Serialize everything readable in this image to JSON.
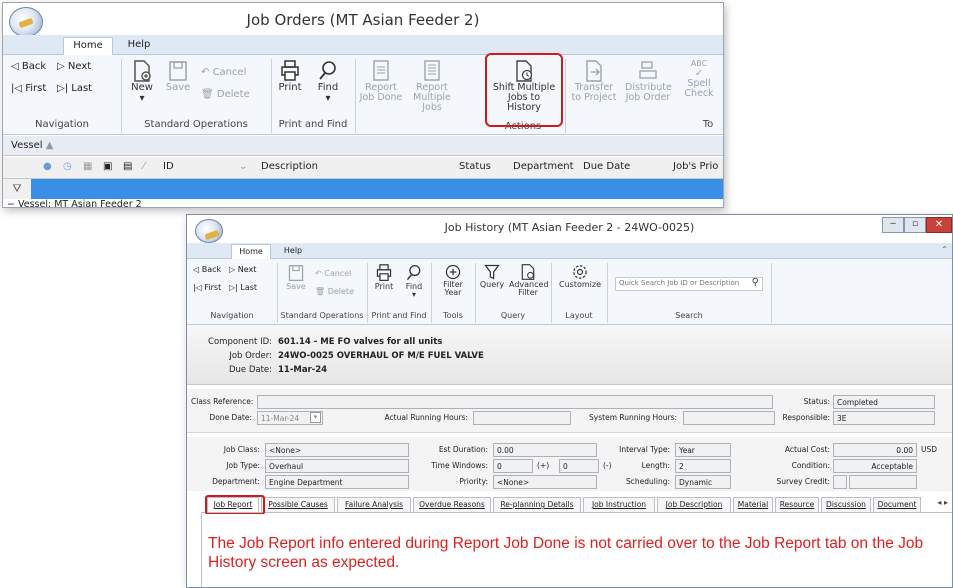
{
  "back_window": {
    "title": "Job Orders (MT Asian Feeder 2)",
    "tabs": [
      "Home",
      "Help"
    ],
    "navigation": {
      "back": "Back",
      "next": "Next",
      "first": "First",
      "last": "Last",
      "group": "Navigation"
    },
    "standard_ops": {
      "new": "New",
      "save": "Save",
      "cancel": "Cancel",
      "delete": "Delete",
      "group": "Standard Operations"
    },
    "print_find": {
      "print": "Print",
      "find": "Find",
      "group": "Print and Find"
    },
    "actions": {
      "report_job_done": "Report Job Done",
      "report_multiple_jobs": "Report Multiple Jobs",
      "shift_multiple_jobs": "Shift Multiple Jobs to History",
      "group": "Actions"
    },
    "more": {
      "transfer_to_project": "Transfer to Project",
      "distribute_job_order": "Distribute Job Order",
      "spell_check": "Spell Check",
      "abc": "ABC",
      "tools_group": "To"
    },
    "group_by": "Vessel",
    "columns": [
      "ID",
      "Description",
      "Status",
      "Department",
      "Due Date",
      "Job's Prio"
    ],
    "group_row": "Vessel:  MT Asian Feeder 2"
  },
  "front_window": {
    "title": "Job History (MT Asian Feeder 2 - 24WO-0025)",
    "tabs": [
      "Home",
      "Help"
    ],
    "navigation": {
      "back": "Back",
      "next": "Next",
      "first": "First",
      "last": "Last",
      "group": "Navigation"
    },
    "standard_ops": {
      "save": "Save",
      "cancel": "Cancel",
      "delete": "Delete",
      "group": "Standard Operations"
    },
    "print_find": {
      "print": "Print",
      "find": "Find",
      "group": "Print and Find"
    },
    "tools": {
      "filter_year": "Filter Year",
      "group": "Tools"
    },
    "query": {
      "query": "Query",
      "advanced_filter": "Advanced Filter",
      "group": "Query"
    },
    "layout": {
      "customize": "Customize",
      "group": "Layout"
    },
    "search": {
      "placeholder": "Quick Search Job ID or Description",
      "group": "Search"
    },
    "header": {
      "component_label": "Component ID:",
      "component_value": "601.14 - ME FO valves for all units",
      "job_order_label": "Job Order:",
      "job_order_value": "24WO-0025 OVERHAUL OF M/E FUEL VALVE",
      "due_label": "Due Date:",
      "due_value": "11-Mar-24"
    },
    "form": {
      "class_reference_label": "Class Reference:",
      "class_reference": "",
      "status_label": "Status:",
      "status": "Completed",
      "done_date_label": "Done Date:",
      "done_date": "11-Mar-24",
      "actual_running_hours_label": "Actual Running Hours:",
      "system_running_hours_label": "System Running Hours:",
      "responsible_label": "Responsible:",
      "responsible": "3E",
      "job_class_label": "Job Class:",
      "job_class": "<None>",
      "est_duration_label": "Est Duration:",
      "est_duration": "0.00",
      "interval_type_label": "Interval Type:",
      "interval_type": "Year",
      "actual_cost_label": "Actual Cost:",
      "actual_cost": "0.00",
      "currency": "USD",
      "job_type_label": "Job Type:",
      "job_type": "Overhaul",
      "time_windows_label": "Time Windows:",
      "time_window_plus": "0",
      "plus_sign": "(+)",
      "time_window_minus": "0",
      "minus_sign": "(-)",
      "length_label": "Length:",
      "length": "2",
      "condition_label": "Condition:",
      "condition": "Acceptable",
      "department_label": "Department:",
      "department": "Engine Department",
      "priority_label": "Priority:",
      "priority": "<None>",
      "scheduling_label": "Scheduling:",
      "scheduling": "Dynamic",
      "survey_credit_label": "Survey Credit:"
    },
    "detail_tabs": [
      "Job Report",
      "Possible Causes",
      "Failure Analysis",
      "Overdue Reasons",
      "Re-planning Details",
      "Job Instruction",
      "Job Description",
      "Material",
      "Resource",
      "Discussion",
      "Document"
    ]
  },
  "annotation": "The Job Report info entered during Report Job Done is not carried over to the Job Report tab on the Job History screen as expected.",
  "colors": {
    "highlight": "#d11a1a",
    "annotation_text": "#e02020",
    "group_bar": "#3a8ee6"
  }
}
